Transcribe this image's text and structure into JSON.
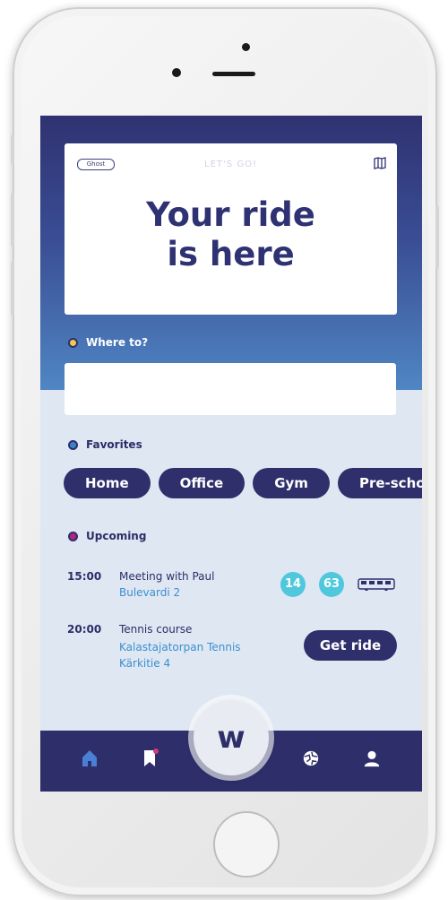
{
  "hero": {
    "logo_text": "Ghost",
    "header": "LET'S GO!",
    "title_line1": "Your ride",
    "title_line2": "is here"
  },
  "where": {
    "label": "Where to?",
    "value": "",
    "dot_color": "#f2c94c"
  },
  "favorites": {
    "label": "Favorites",
    "dot_color": "#3b82c4",
    "items": [
      "Home",
      "Office",
      "Gym",
      "Pre-scho"
    ]
  },
  "upcoming": {
    "label": "Upcoming",
    "dot_color": "#b4247a",
    "events": [
      {
        "time": "15:00",
        "title": "Meeting with Paul",
        "location": "Bulevardi 2",
        "badges": [
          "14",
          "63"
        ]
      },
      {
        "time": "20:00",
        "title": "Tennis course",
        "location_line1": "Kalastajatorpan Tennis",
        "location_line2": "Kärkitie 4",
        "action": "Get ride"
      }
    ]
  },
  "fab": {
    "glyph": "w"
  },
  "nav": {
    "items": [
      "home-icon",
      "bookmark-icon",
      "globe-icon",
      "profile-icon"
    ]
  },
  "colors": {
    "primary": "#2e2f6b",
    "accent": "#4fc8dd",
    "link": "#3b8fd0",
    "active_nav": "#4a7fd6"
  }
}
